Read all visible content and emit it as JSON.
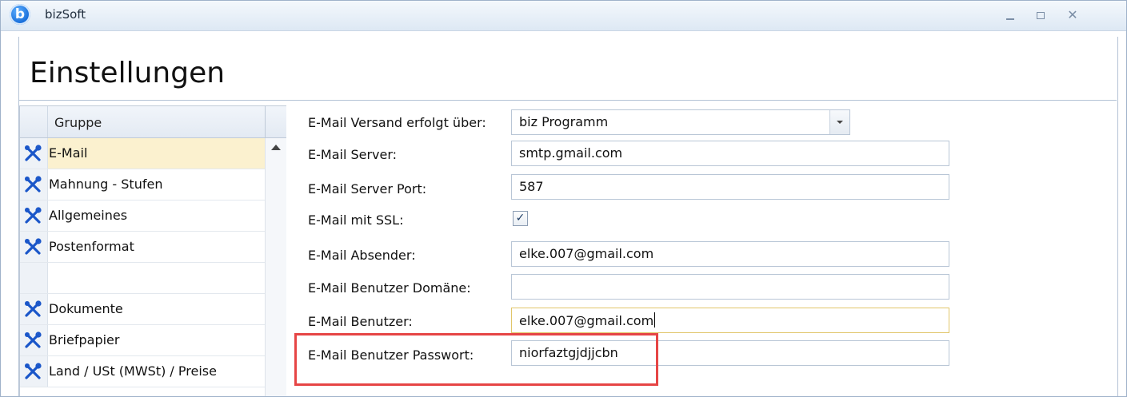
{
  "window": {
    "app_title": "bizSoft",
    "logo_letter": "b",
    "close_glyph": "✕"
  },
  "header": {
    "title": "Einstellungen"
  },
  "groups": {
    "column_label": "Gruppe",
    "items": [
      {
        "label": "E-Mail",
        "icon": "tools-icon",
        "selected": true
      },
      {
        "label": "Mahnung - Stufen",
        "icon": "tools-icon"
      },
      {
        "label": "Allgemeines",
        "icon": "tools-icon"
      },
      {
        "label": "Postenformat",
        "icon": "tools-icon"
      },
      {
        "label": "",
        "icon": ""
      },
      {
        "label": "Dokumente",
        "icon": "tools-icon"
      },
      {
        "label": "Briefpapier",
        "icon": "tools-icon"
      },
      {
        "label": "Land / USt (MWSt) / Preise",
        "icon": "tools-icon"
      }
    ]
  },
  "form": {
    "versand": {
      "label": "E-Mail Versand erfolgt über:",
      "value": "biz Programm"
    },
    "server": {
      "label": "E-Mail Server:",
      "value": "smtp.gmail.com"
    },
    "port": {
      "label": "E-Mail Server Port:",
      "value": "587"
    },
    "ssl": {
      "label": "E-Mail mit SSL:",
      "checked": true,
      "glyph": "✓"
    },
    "absender": {
      "label": "E-Mail Absender:",
      "value": "elke.007@gmail.com"
    },
    "domaene": {
      "label": "E-Mail Benutzer Domäne:",
      "value": ""
    },
    "benutzer": {
      "label": "E-Mail Benutzer:",
      "value": "elke.007@gmail.com"
    },
    "passwort": {
      "label": "E-Mail Benutzer Passwort:",
      "value": "niorfaztgjdjjcbn"
    }
  },
  "colors": {
    "highlight": "#e64545",
    "selected_row": "#fbf1cf",
    "tool_icon": "#1a56c9"
  }
}
